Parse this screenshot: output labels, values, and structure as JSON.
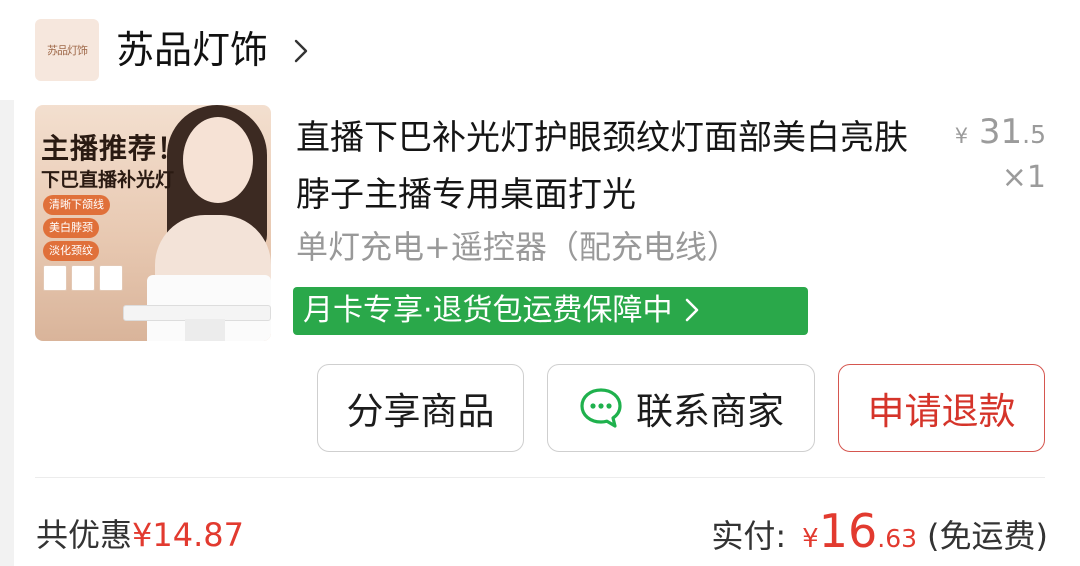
{
  "store": {
    "logo_text": "苏品灯饰",
    "name": "苏品灯饰"
  },
  "product": {
    "title": "直播下巴补光灯护眼颈纹灯面部美白亮肤脖子主播专用桌面打光",
    "price_currency": "¥",
    "price_int": "31",
    "price_dec": ".5",
    "quantity": "×1",
    "sku": "单灯充电+遥控器（配充电线）",
    "badge": "月卡专享·退货包运费保障中",
    "image": {
      "headline": "主播推荐！",
      "subline": "下巴直播补光灯",
      "tags": [
        "清晰下颌线",
        "美白脖颈",
        "淡化颈纹"
      ]
    }
  },
  "actions": {
    "share": "分享商品",
    "contact": "联系商家",
    "refund": "申请退款"
  },
  "summary": {
    "discount_label": "共优惠",
    "discount_amount": "¥14.87",
    "paid_label": "实付:",
    "paid_currency": "¥",
    "paid_int": "16",
    "paid_dec": ".63",
    "shipping": "(免运费)"
  },
  "colors": {
    "accent_red": "#e23a2f",
    "badge_green": "#2aa84a",
    "wechat_green": "#1fb14d"
  }
}
